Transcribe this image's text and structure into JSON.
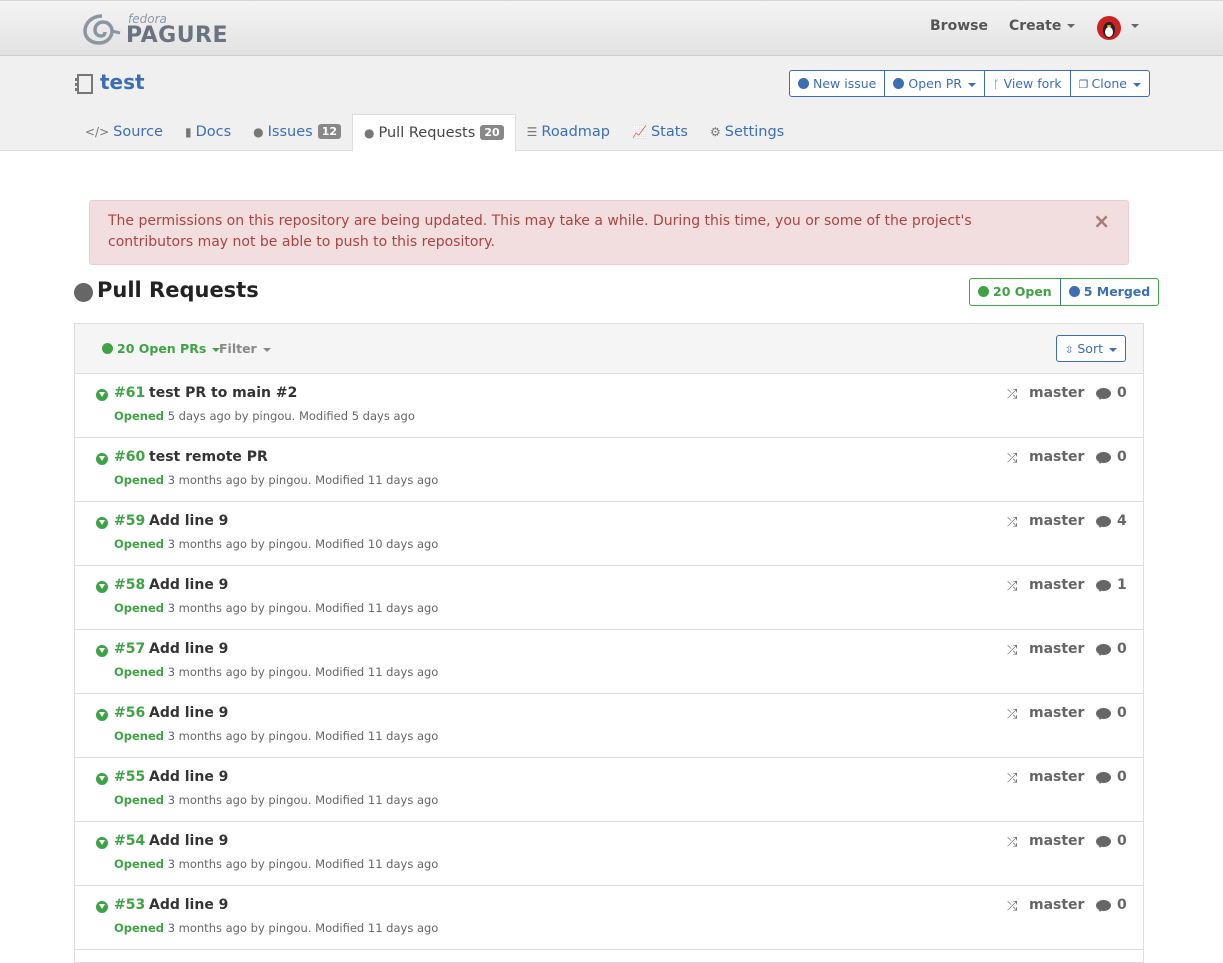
{
  "brand": {
    "small": "fedora",
    "name": "PAGURE"
  },
  "topnav": {
    "browse": "Browse",
    "create": "Create"
  },
  "repo": {
    "name": "test"
  },
  "actions": {
    "new_issue": "New issue",
    "open_pr": "Open PR",
    "view_fork": "View fork",
    "clone": "Clone"
  },
  "tabs": [
    {
      "label": "Source",
      "icon": "code-icon"
    },
    {
      "label": "Docs",
      "icon": "book-icon"
    },
    {
      "label": "Issues",
      "icon": "exclamation-icon",
      "count": "12"
    },
    {
      "label": "Pull Requests",
      "icon": "arrow-circle-down-icon",
      "count": "20"
    },
    {
      "label": "Roadmap",
      "icon": "signpost-icon"
    },
    {
      "label": "Stats",
      "icon": "line-chart-icon"
    },
    {
      "label": "Settings",
      "icon": "cogs-icon"
    }
  ],
  "alert": {
    "text": "The permissions on this repository are being updated. This may take a while. During this time, you or some of the project's contributors may not be able to push to this repository.",
    "close": "×"
  },
  "pr_section": {
    "title": "Pull Requests",
    "open_badge": "20 Open",
    "merged_badge": "5 Merged"
  },
  "panel": {
    "open_filter": "20 Open PRs",
    "filter": "Filter",
    "sort": "Sort"
  },
  "prs": [
    {
      "num": "#61",
      "title": "test PR to main #2",
      "opened": "Opened",
      "meta": "5 days ago by pingou. Modified 5 days ago",
      "branch": "master",
      "comments": "0"
    },
    {
      "num": "#60",
      "title": "test remote PR",
      "opened": "Opened",
      "meta": "3 months ago by pingou. Modified 11 days ago",
      "branch": "master",
      "comments": "0"
    },
    {
      "num": "#59",
      "title": "Add line 9",
      "opened": "Opened",
      "meta": "3 months ago by pingou. Modified 10 days ago",
      "branch": "master",
      "comments": "4"
    },
    {
      "num": "#58",
      "title": "Add line 9",
      "opened": "Opened",
      "meta": "3 months ago by pingou. Modified 11 days ago",
      "branch": "master",
      "comments": "1"
    },
    {
      "num": "#57",
      "title": "Add line 9",
      "opened": "Opened",
      "meta": "3 months ago by pingou. Modified 11 days ago",
      "branch": "master",
      "comments": "0"
    },
    {
      "num": "#56",
      "title": "Add line 9",
      "opened": "Opened",
      "meta": "3 months ago by pingou. Modified 11 days ago",
      "branch": "master",
      "comments": "0"
    },
    {
      "num": "#55",
      "title": "Add line 9",
      "opened": "Opened",
      "meta": "3 months ago by pingou. Modified 11 days ago",
      "branch": "master",
      "comments": "0"
    },
    {
      "num": "#54",
      "title": "Add line 9",
      "opened": "Opened",
      "meta": "3 months ago by pingou. Modified 11 days ago",
      "branch": "master",
      "comments": "0"
    },
    {
      "num": "#53",
      "title": "Add line 9",
      "opened": "Opened",
      "meta": "3 months ago by pingou. Modified 11 days ago",
      "branch": "master",
      "comments": "0"
    }
  ],
  "colors": {
    "link": "#3c6eb4",
    "open": "#3fa346",
    "alert_bg": "#f2dede",
    "alert_text": "#a94442"
  }
}
